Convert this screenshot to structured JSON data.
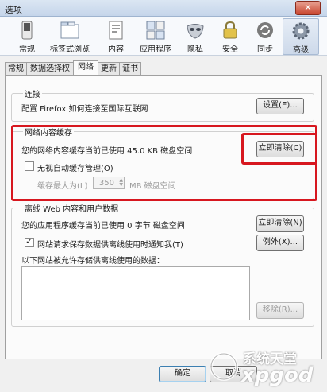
{
  "window": {
    "title": "选项",
    "close_glyph": "✕"
  },
  "toolbar": {
    "items": [
      {
        "label": "常规",
        "icon": "switch-icon"
      },
      {
        "label": "标签式浏览",
        "icon": "tabs-icon"
      },
      {
        "label": "内容",
        "icon": "page-icon"
      },
      {
        "label": "应用程序",
        "icon": "applications-icon"
      },
      {
        "label": "隐私",
        "icon": "mask-icon"
      },
      {
        "label": "安全",
        "icon": "lock-icon"
      },
      {
        "label": "同步",
        "icon": "sync-icon"
      },
      {
        "label": "高级",
        "icon": "gear-icon",
        "active": true
      }
    ]
  },
  "tabs": [
    "常规",
    "数据选择权",
    "网络",
    "更新",
    "证书"
  ],
  "connection": {
    "title": "连接",
    "desc": "配置 Firefox 如何连接至国际互联网",
    "settings_button": "设置(E)..."
  },
  "cache": {
    "title": "网络内容缓存",
    "usage": "您的网络内容缓存当前已使用 45.0 KB 磁盘空间",
    "clear_button": "立即清除(C)",
    "override_label": "无视自动缓存管理(O)",
    "override_checked": false,
    "limit_label": "缓存最大为(L)",
    "limit_value": "350",
    "limit_unit": "MB 磁盘空间"
  },
  "offline": {
    "title": "离线 Web 内容和用户数据",
    "usage": "您的应用程序缓存当前已使用 0 字节 磁盘空间",
    "clear_button": "立即清除(N)",
    "notify_label": "网站请求保存数据供离线使用时通知我(T)",
    "notify_checked": true,
    "exceptions_button": "例外(X)...",
    "list_label": "以下网站被允许存储供离线使用的数据：",
    "remove_button": "移除(R)..."
  },
  "footer": {
    "ok_button": "确定",
    "cancel_button": "取消"
  },
  "watermark": {
    "text": "系统天堂",
    "subtext": "xpgod"
  },
  "colors": {
    "highlight": "#d7171f"
  }
}
